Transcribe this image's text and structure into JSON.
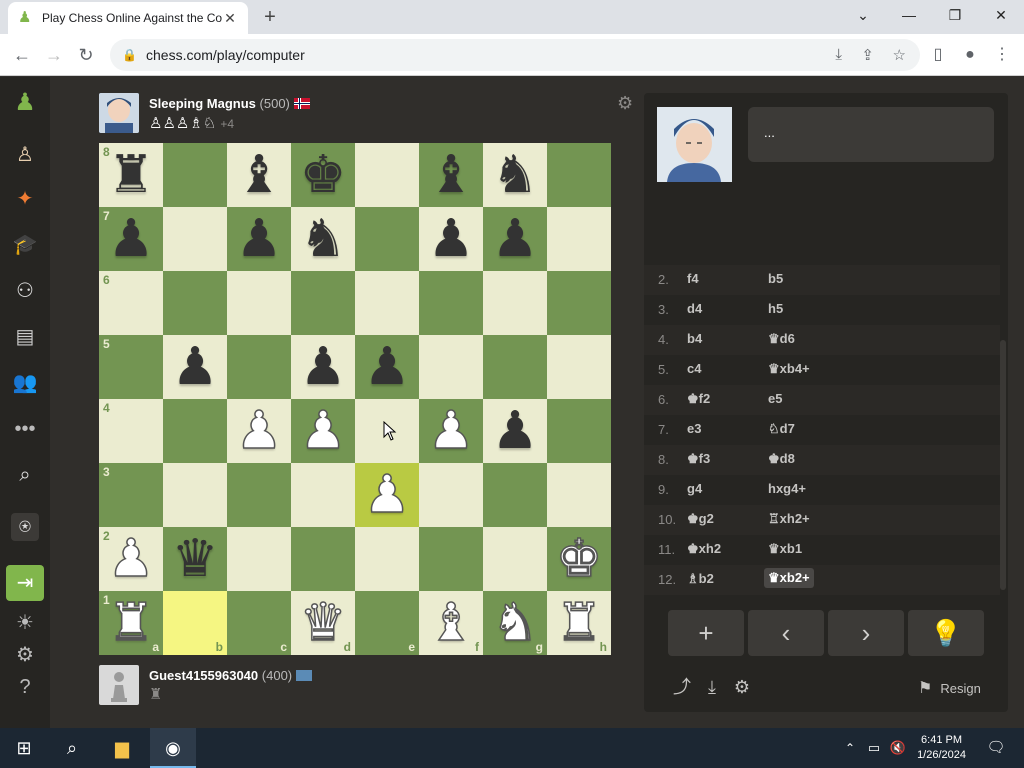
{
  "browser": {
    "tab_title": "Play Chess Online Against the Co",
    "url": "chess.com/play/computer"
  },
  "top_player": {
    "name": "Sleeping Magnus",
    "rating": "(500)",
    "flag": "NO",
    "captures": "♙♙♙♗♘",
    "advantage": "+4"
  },
  "bottom_player": {
    "name": "Guest4155963040",
    "rating": "(400)",
    "captures": "♜"
  },
  "board": {
    "ranks": [
      "8",
      "7",
      "6",
      "5",
      "4",
      "3",
      "2",
      "1"
    ],
    "files": [
      "a",
      "b",
      "c",
      "d",
      "e",
      "f",
      "g",
      "h"
    ],
    "position": [
      [
        "bR",
        "",
        "bB",
        "bK",
        "",
        "bB",
        "bN",
        ""
      ],
      [
        "bP",
        "",
        "bP",
        "bN",
        "",
        "bP",
        "bP",
        ""
      ],
      [
        "",
        "",
        "",
        "",
        "",
        "",
        "",
        ""
      ],
      [
        "",
        "bP",
        "",
        "bP",
        "bP",
        "",
        "",
        ""
      ],
      [
        "",
        "",
        "wP",
        "wP",
        "",
        "wP",
        "bP",
        ""
      ],
      [
        "",
        "",
        "",
        "",
        "wP",
        "",
        "",
        ""
      ],
      [
        "wP",
        "bQ",
        "",
        "",
        "",
        "",
        "",
        "wK"
      ],
      [
        "wR",
        "",
        "",
        "wQ",
        "",
        "wB",
        "wN",
        "wR"
      ]
    ],
    "highlights": [
      "e3",
      "b1"
    ]
  },
  "chat": {
    "bubble_text": "..."
  },
  "moves": [
    {
      "n": "2.",
      "w": "f4",
      "b": "b5"
    },
    {
      "n": "3.",
      "w": "d4",
      "b": "h5"
    },
    {
      "n": "4.",
      "w": "b4",
      "b": "♛d6"
    },
    {
      "n": "5.",
      "w": "c4",
      "b": "♛xb4+"
    },
    {
      "n": "6.",
      "w": "♚f2",
      "b": "e5"
    },
    {
      "n": "7.",
      "w": "e3",
      "b": "♘d7"
    },
    {
      "n": "8.",
      "w": "♚f3",
      "b": "♚d8"
    },
    {
      "n": "9.",
      "w": "g4",
      "b": "hxg4+"
    },
    {
      "n": "10.",
      "w": "♚g2",
      "b": "♖xh2+"
    },
    {
      "n": "11.",
      "w": "♚xh2",
      "b": "♛xb1"
    },
    {
      "n": "12.",
      "w": "♗b2",
      "b": "♛xb2+"
    }
  ],
  "controls": {
    "add": "+",
    "prev": "‹",
    "next": "›",
    "hint": "💡",
    "resign_label": "Resign"
  },
  "taskbar": {
    "time": "6:41 PM",
    "date": "1/26/2024",
    "notifications": "1"
  },
  "colors": {
    "board_light": "#ebecd0",
    "board_dark": "#739552",
    "brand_green": "#81b64c"
  }
}
